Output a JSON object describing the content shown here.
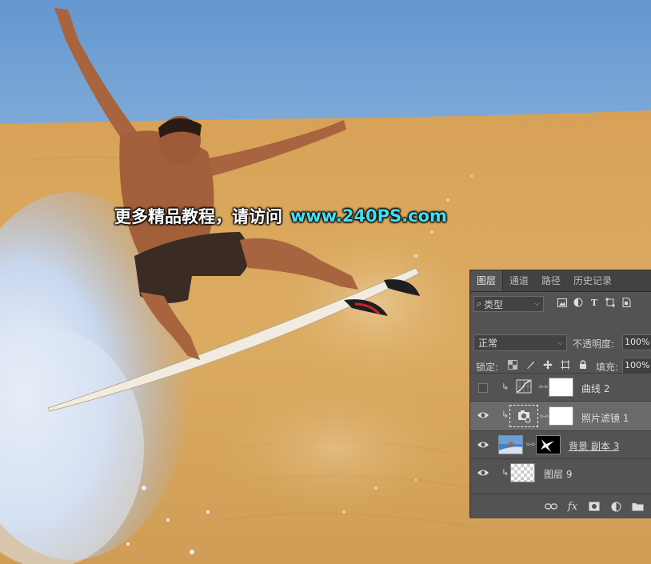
{
  "watermark": {
    "text_cn": "更多精品教程，请访问",
    "url": "www.240PS.com"
  },
  "layers_panel": {
    "tabs": [
      {
        "label": "图层",
        "active": true
      },
      {
        "label": "通道",
        "active": false
      },
      {
        "label": "路径",
        "active": false
      },
      {
        "label": "历史记录",
        "active": false
      }
    ],
    "filter": {
      "kind_label": "类型",
      "icons": [
        "image-filter-icon",
        "adjustment-filter-icon",
        "type-filter-icon",
        "shape-filter-icon",
        "smart-object-filter-icon"
      ]
    },
    "blend_mode": "正常",
    "opacity_label": "不透明度:",
    "opacity_value": "100%",
    "lock_label": "锁定:",
    "fill_label": "填充:",
    "fill_value": "100%",
    "layers": [
      {
        "name": "曲线 2",
        "visible": false,
        "clipped": true,
        "type": "curves-adjustment",
        "selected": false
      },
      {
        "name": "照片滤镜 1",
        "visible": true,
        "clipped": true,
        "type": "photo-filter-adjustment",
        "selected": true
      },
      {
        "name": "背景 副本 3",
        "visible": true,
        "clipped": false,
        "type": "image-with-mask",
        "selected": false
      },
      {
        "name": "图层 9",
        "visible": true,
        "clipped": true,
        "type": "empty-layer",
        "selected": false
      }
    ],
    "bottom_icons": [
      "link-layers-icon",
      "fx-icon",
      "add-mask-icon",
      "new-adjustment-icon",
      "new-group-icon"
    ],
    "fx_label": "fx"
  },
  "colors": {
    "sky": "#6d9fd3",
    "sand": "#d9a95c",
    "panel_bg": "#535353",
    "panel_tab_bg": "#424242",
    "watermark_url": "#3fe0f2"
  }
}
